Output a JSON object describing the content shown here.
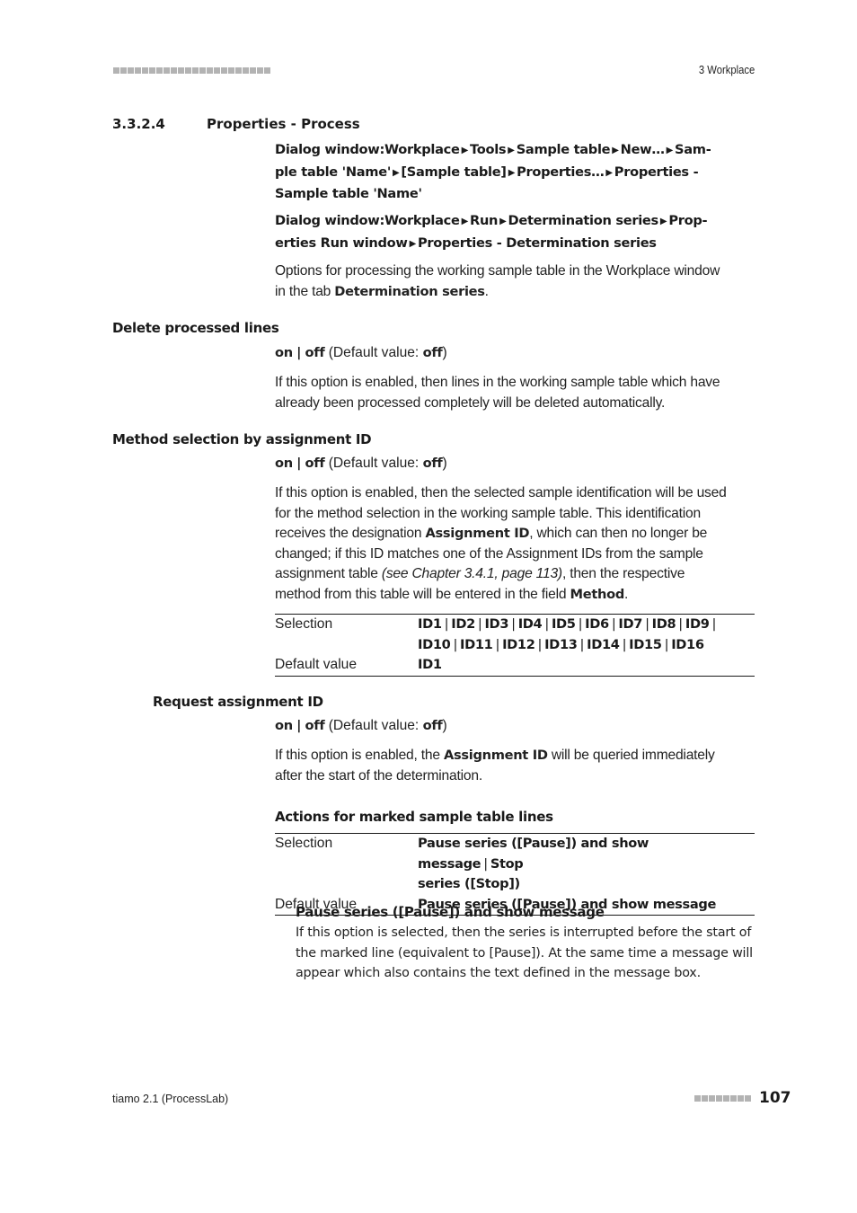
{
  "header": {
    "chapter": "3 Workplace"
  },
  "section": {
    "number": "3.3.2.4",
    "title": "Properties - Process"
  },
  "nav_paths": [
    {
      "line1": [
        "Dialog window:Workplace",
        "Tools",
        "Sample table",
        "New…",
        "Sam-"
      ],
      "line2": [
        "ple table 'Name'",
        "[Sample table]",
        "Properties…",
        "Properties -"
      ],
      "line3": [
        "Sample table 'Name'"
      ]
    },
    {
      "line1": [
        "Dialog window:Workplace",
        "Run",
        "Determination series",
        "Prop-"
      ],
      "line2": [
        "erties Run window",
        "Properties - Determination series"
      ]
    }
  ],
  "intro": {
    "text_pre": "Options for processing the working sample table in the Workplace window",
    "text_line2_pre": "in the tab ",
    "text_bold": "Determination series",
    "text_post": "."
  },
  "options": {
    "delete_processed_lines": {
      "label": "Delete processed lines",
      "on": "on",
      "sep": "|",
      "off": "off",
      "default_pre": "(Default value: ",
      "default_val": "off",
      "default_post": ")",
      "desc_lines": [
        "If this option is enabled, then lines in the working sample table which have",
        "already been processed completely will be deleted automatically."
      ]
    },
    "method_selection": {
      "label": "Method selection by assignment ID",
      "on": "on",
      "sep": "|",
      "off": "off",
      "default_pre": "(Default value: ",
      "default_val": "off",
      "default_post": ")",
      "desc_line1": "If this option is enabled, then the selected sample identification will be used",
      "desc_line2": "for the method selection in the working sample table. This identification",
      "desc_line3_pre": "receives the designation ",
      "desc_line3_bold": "Assignment ID",
      "desc_line3_post": ", which can then no longer be",
      "desc_line4": "changed; if this ID matches one of the Assignment IDs from the sample",
      "desc_line5_pre": "assignment table ",
      "desc_line5_italic": "(see Chapter 3.4.1, page 113)",
      "desc_line5_post": ", then the respective",
      "desc_line6_pre": "method from this table will be entered in the field ",
      "desc_line6_bold": "Method",
      "desc_line6_post": ".",
      "table": {
        "selection_label": "Selection",
        "selection_line1": [
          "ID1",
          "ID2",
          "ID3",
          "ID4",
          "ID5",
          "ID6",
          "ID7",
          "ID8",
          "ID9"
        ],
        "selection_line2": [
          "ID10",
          "ID11",
          "ID12",
          "ID13",
          "ID14",
          "ID15",
          "ID16"
        ],
        "default_label": "Default value",
        "default_value": "ID1"
      }
    },
    "request_assignment_id": {
      "label": "Request assignment ID",
      "on": "on",
      "sep": "|",
      "off": "off",
      "default_pre": "(Default value: ",
      "default_val": "off",
      "default_post": ")",
      "desc_line1_pre": "If this option is enabled, the ",
      "desc_line1_bold": "Assignment ID",
      "desc_line1_post": " will be queried immediately",
      "desc_line2": "after the start of the determination."
    },
    "actions_marked_lines": {
      "label": "Actions for marked sample table lines",
      "table": {
        "selection_label": "Selection",
        "selection_opt1": "Pause series ([Pause]) and show message",
        "selection_opt2_line1": "Stop",
        "selection_opt2_line2": "series ([Stop])",
        "default_label": "Default value",
        "default_value": "Pause series ([Pause]) and show message"
      },
      "sub_option": {
        "title": "Pause series ([Pause]) and show message",
        "desc_lines": [
          "If this option is selected, then the series is interrupted before the start of",
          "the marked line (equivalent to [Pause]). At the same time a message will",
          "appear which also contains the text defined in the message box."
        ]
      }
    }
  },
  "footer": {
    "product": "tiamo 2.1 (ProcessLab)",
    "page_number": "107"
  },
  "colors": {
    "text": "#1a1a1a",
    "decorative_squares": "#b3b3b3"
  }
}
